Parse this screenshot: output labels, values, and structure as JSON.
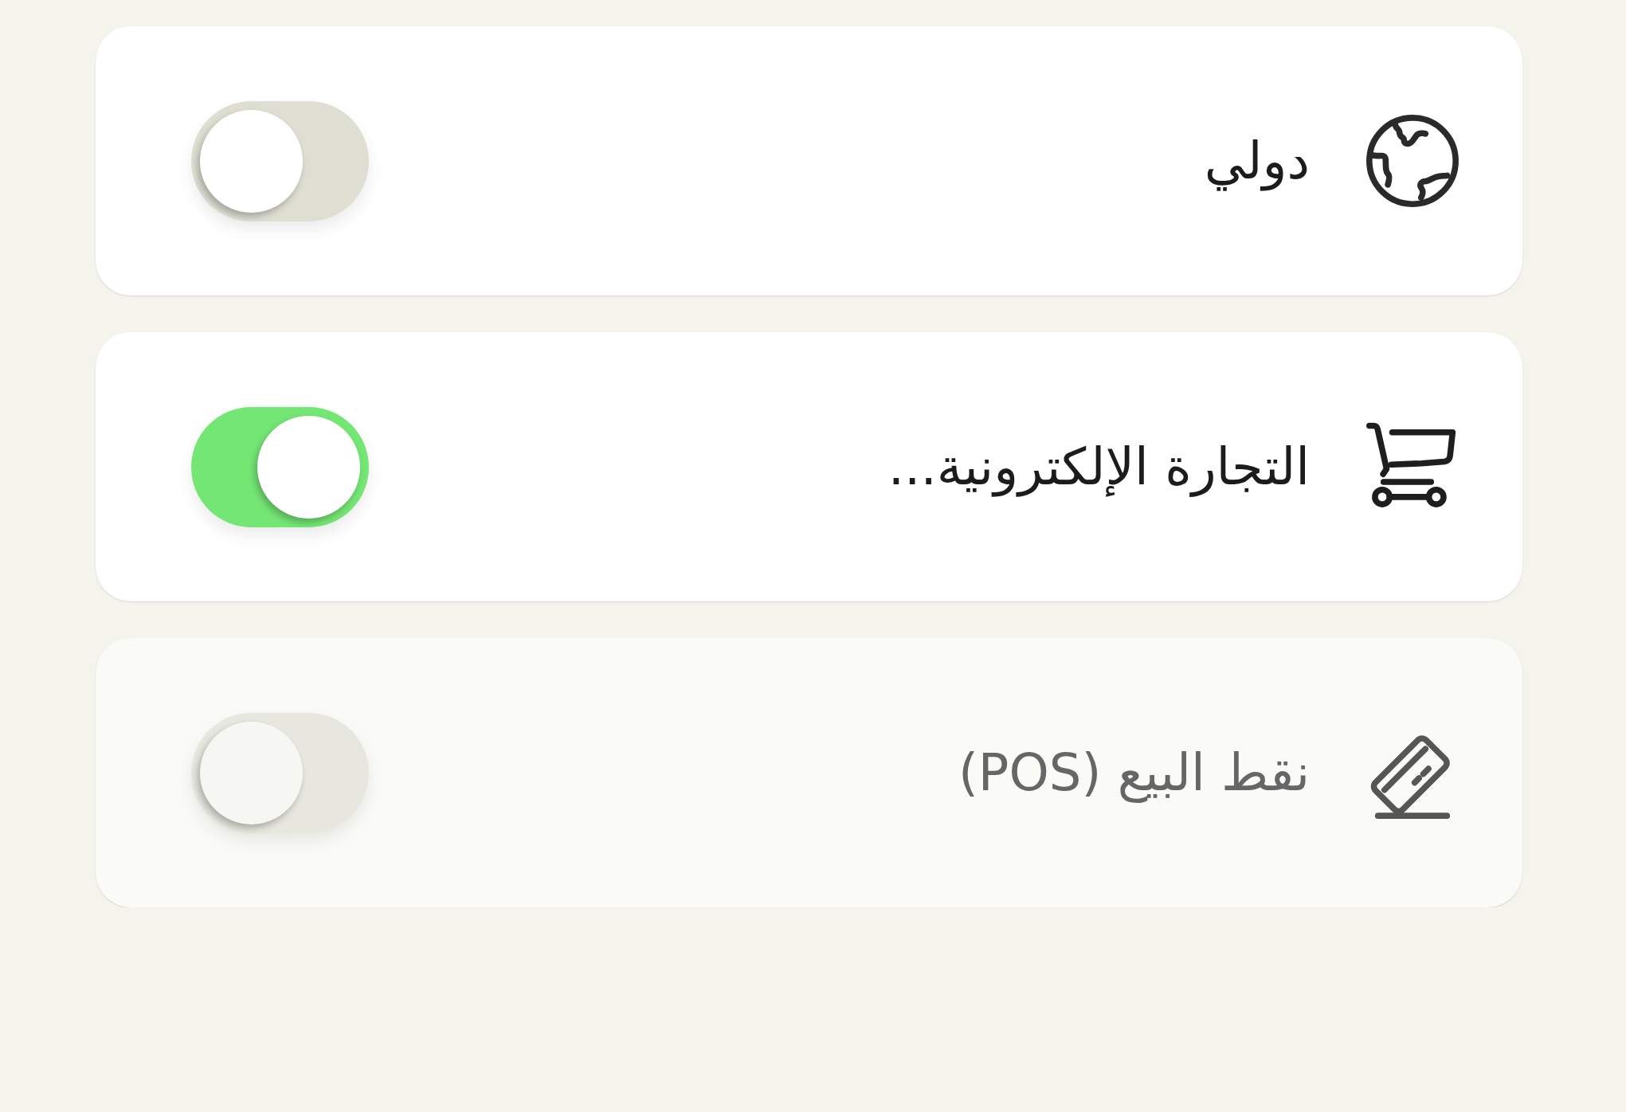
{
  "settings": [
    {
      "label": "دولي",
      "on": false,
      "disabled": false
    },
    {
      "label": "التجارة الإلكترونية...",
      "on": true,
      "disabled": false
    },
    {
      "label": "نقط البيع (POS)",
      "on": false,
      "disabled": true
    }
  ]
}
